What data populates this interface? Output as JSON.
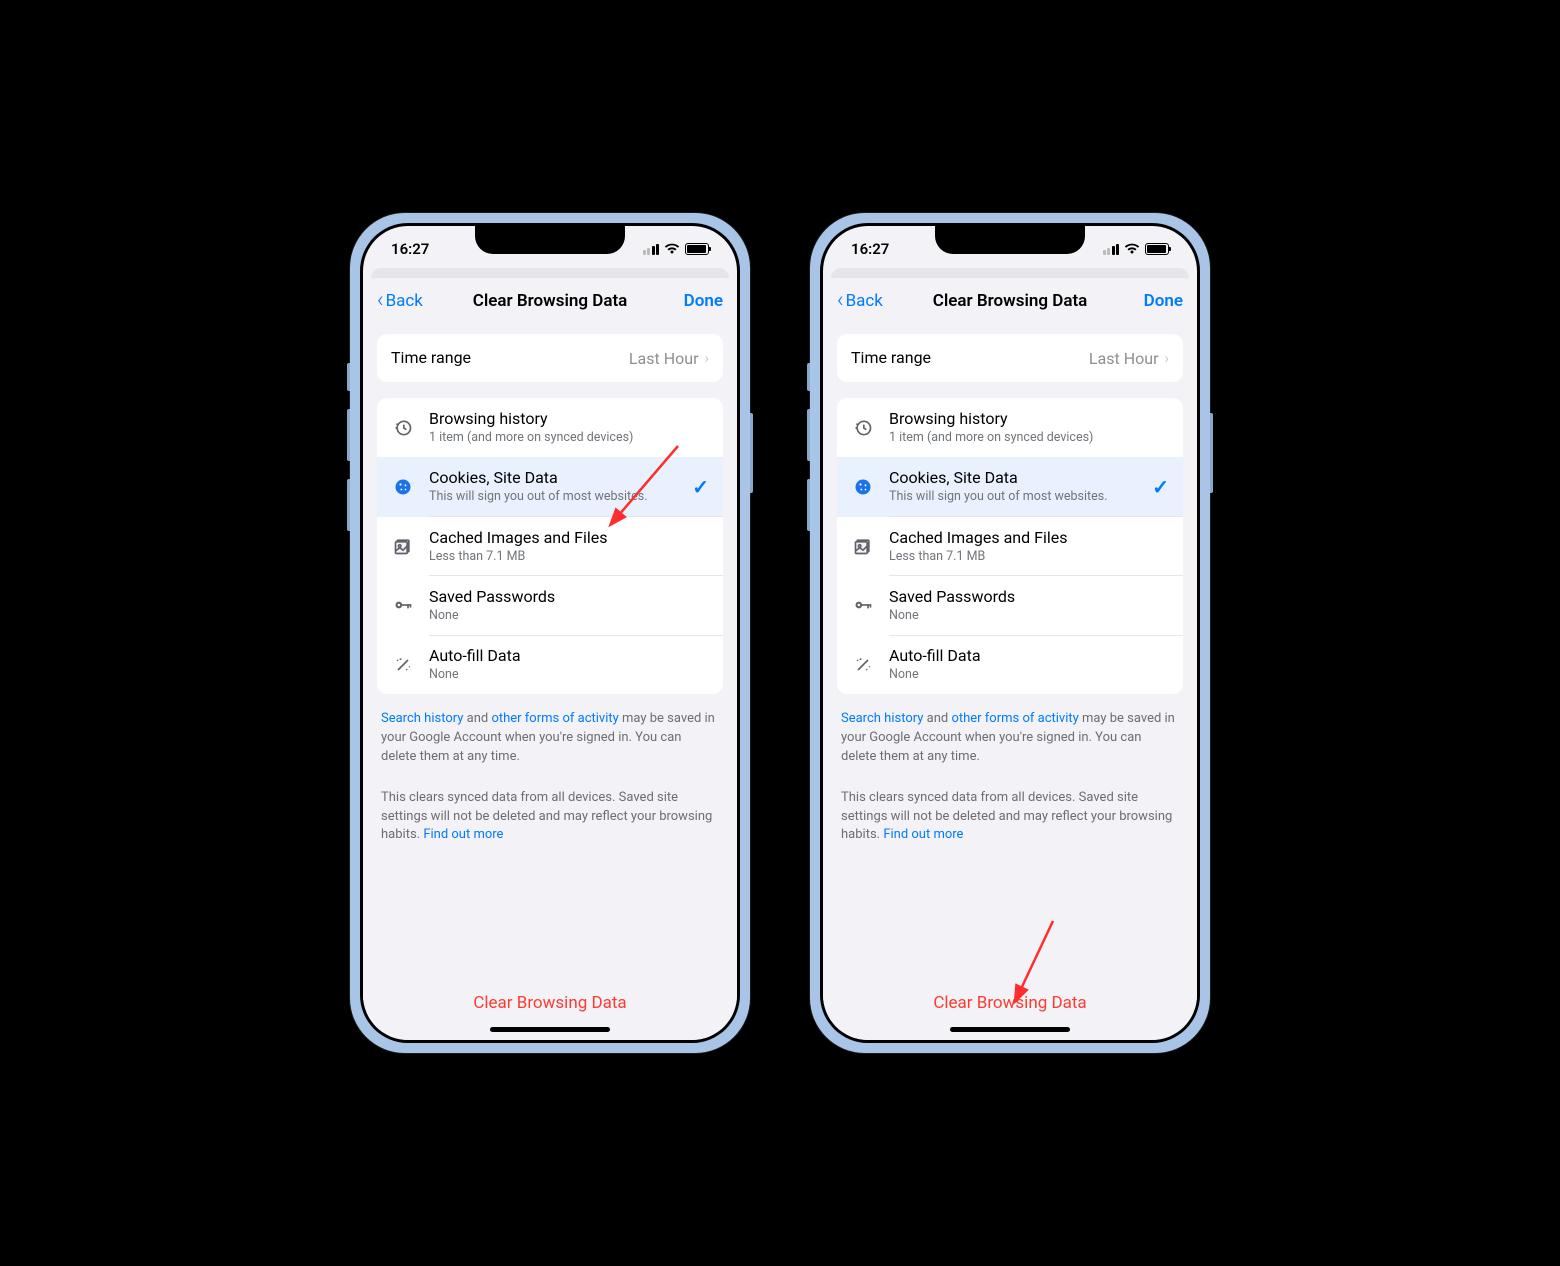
{
  "status": {
    "time": "16:27"
  },
  "nav": {
    "back": "Back",
    "title": "Clear Browsing Data",
    "done": "Done"
  },
  "timeRange": {
    "label": "Time range",
    "value": "Last Hour"
  },
  "items": {
    "history": {
      "title": "Browsing history",
      "sub": "1 item (and more on synced devices)"
    },
    "cookies": {
      "title": "Cookies, Site Data",
      "sub": "This will sign you out of most websites."
    },
    "cache": {
      "title": "Cached Images and Files",
      "sub": "Less than 7.1 MB"
    },
    "passwords": {
      "title": "Saved Passwords",
      "sub": "None"
    },
    "autofill": {
      "title": "Auto-fill Data",
      "sub": "None"
    }
  },
  "info1": {
    "link1": "Search history",
    "mid1": " and ",
    "link2": "other forms of activity",
    "rest": " may be saved in your Google Account when you're signed in. You can delete them at any time."
  },
  "info2": {
    "text": "This clears synced data from all devices. Saved site settings will not be deleted and may reflect your browsing habits. ",
    "link": "Find out more"
  },
  "clear": "Clear Browsing Data"
}
